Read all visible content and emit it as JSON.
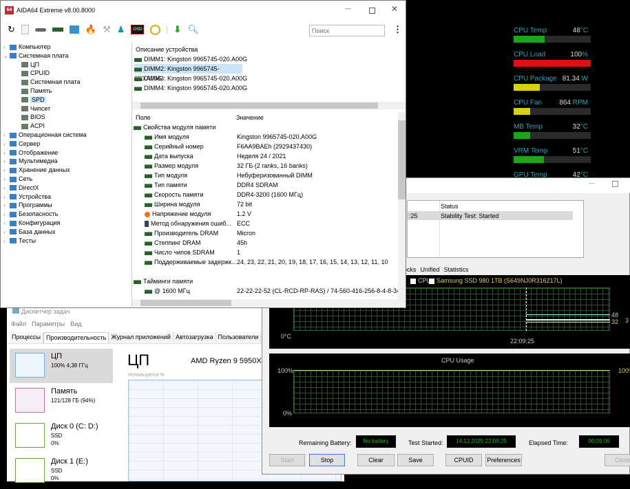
{
  "sensors": [
    {
      "label": "CPU Temp",
      "value": "48",
      "unit": "°C",
      "fill": 0.4,
      "color": "#1aa81a"
    },
    {
      "label": "CPU Load",
      "value": "100",
      "unit": "%",
      "fill": 1.0,
      "color": "#e01010"
    },
    {
      "label": "CPU Package",
      "value": "81.34",
      "unit": " W",
      "fill": 0.34,
      "color": "#d8d010"
    },
    {
      "label": "CPU Fan",
      "value": "864",
      "unit": " RPM",
      "fill": 0.21,
      "color": "#d8d010"
    },
    {
      "label": "MB Temp",
      "value": "32",
      "unit": "°C",
      "fill": 0.21,
      "color": "#1aa81a"
    },
    {
      "label": "VRM Temp",
      "value": "51",
      "unit": "°C",
      "fill": 0.39,
      "color": "#1aa81a"
    },
    {
      "label": "GPU Temp",
      "value": "42",
      "unit": "°C",
      "fill": 0.3,
      "color": "#1aa81a"
    }
  ],
  "stability": {
    "log_time": ":25",
    "status_header": "Status",
    "status_value": "Stability Test: Started",
    "tabs": [
      "ocks",
      "Unified",
      "Statistics"
    ],
    "legend": [
      "CPU",
      "Samsung SSD 980 1TB (S649NJ0R316217L)"
    ],
    "temp_axis_min": "0°C",
    "temp_time": "22:09:25",
    "temp_val1": "48",
    "temp_val2": "32",
    "temp_val3": "3",
    "cpu_usage_title": "CPU Usage",
    "cpu_axis_max": "100%",
    "cpu_axis_min": "0%",
    "cpu_right": "100%",
    "battery_label": "Remaining Battery:",
    "battery_value": "No battery",
    "started_label": "Test Started:",
    "started_value": "14.12.2025 22:09:25",
    "elapsed_label": "Elapsed Time:",
    "elapsed_value": "00:09:05",
    "buttons": {
      "start": "Start",
      "stop": "Stop",
      "clear": "Clear",
      "save": "Save",
      "cpuid": "CPUID",
      "preferences": "Preferences",
      "close": "Close"
    }
  },
  "taskmgr": {
    "title": "Диспетчер задач",
    "menu": [
      "Файл",
      "Параметры",
      "Вид"
    ],
    "tabs": [
      "Процессы",
      "Производительность",
      "Журнал приложений",
      "Автозагрузка",
      "Пользователи"
    ],
    "items": [
      {
        "name": "ЦП",
        "sub": "100% 4,38 ГГц",
        "sub2": ""
      },
      {
        "name": "Память",
        "sub": "121/128 ГБ (94%)",
        "sub2": ""
      },
      {
        "name": "Диск 0 (C: D:)",
        "sub": "SSD",
        "sub2": "0%"
      },
      {
        "name": "Диск 1 (E:)",
        "sub": "SSD",
        "sub2": "0%"
      }
    ],
    "heading": "ЦП",
    "cpu_model": "AMD Ryzen 9 5950X",
    "usage_label": "Используется %"
  },
  "aida": {
    "title": "AIDA64 Extreme v8.00.8000",
    "search_placeholder": "Поиск",
    "tree": [
      {
        "label": "Компьютер",
        "level": 0,
        "exp": ">"
      },
      {
        "label": "Системная плата",
        "level": 0,
        "exp": "v"
      },
      {
        "label": "ЦП",
        "level": 1
      },
      {
        "label": "CPUID",
        "level": 1
      },
      {
        "label": "Системная плата",
        "level": 1
      },
      {
        "label": "Память",
        "level": 1
      },
      {
        "label": "SPD",
        "level": 1,
        "selected": true
      },
      {
        "label": "Чипсет",
        "level": 1
      },
      {
        "label": "BIOS",
        "level": 1
      },
      {
        "label": "ACPI",
        "level": 1
      },
      {
        "label": "Операционная система",
        "level": 0,
        "exp": ">"
      },
      {
        "label": "Сервер",
        "level": 0,
        "exp": ">"
      },
      {
        "label": "Отображение",
        "level": 0,
        "exp": ">"
      },
      {
        "label": "Мультимедиа",
        "level": 0,
        "exp": ">"
      },
      {
        "label": "Хранение данных",
        "level": 0,
        "exp": ">"
      },
      {
        "label": "Сеть",
        "level": 0,
        "exp": ">"
      },
      {
        "label": "DirectX",
        "level": 0,
        "exp": ">"
      },
      {
        "label": "Устройства",
        "level": 0,
        "exp": ">"
      },
      {
        "label": "Программы",
        "level": 0,
        "exp": ">"
      },
      {
        "label": "Безопасность",
        "level": 0,
        "exp": ">"
      },
      {
        "label": "Конфигурация",
        "level": 0,
        "exp": ">"
      },
      {
        "label": "База данных",
        "level": 0,
        "exp": ">"
      },
      {
        "label": "Тесты",
        "level": 0,
        "exp": ">"
      }
    ],
    "device_header": "Описание устройства",
    "devices": [
      "DIMM1: Kingston 9965745-020.A00G",
      "DIMM2: Kingston 9965745-020.A00G",
      "DIMM3: Kingston 9965745-020.A00G",
      "DIMM4: Kingston 9965745-020.A00G"
    ],
    "selected_device": 1,
    "col_field": "Поле",
    "col_value": "Значение",
    "rows": [
      {
        "f": "Свойства модуля памяти",
        "v": "",
        "group": true
      },
      {
        "f": "Имя модуля",
        "v": "Kingston 9965745-020.A00G"
      },
      {
        "f": "Серийный номер",
        "v": "F6AA9BAEh (2929437430)"
      },
      {
        "f": "Дата выпуска",
        "v": "Неделя 24 / 2021"
      },
      {
        "f": "Размер модуля",
        "v": "32 ГБ (2 ranks, 16 banks)"
      },
      {
        "f": "Тип модуля",
        "v": "Небуферизованный DIMM"
      },
      {
        "f": "Тип памяти",
        "v": "DDR4 SDRAM"
      },
      {
        "f": "Скорость памяти",
        "v": "DDR4-3200 (1600 МГц)"
      },
      {
        "f": "Ширина модуля",
        "v": "72 bit"
      },
      {
        "f": "Напряжение модуля",
        "v": "1.2 V"
      },
      {
        "f": "Метод обнаружения ошиб...",
        "v": "ECC"
      },
      {
        "f": "Производитель DRAM",
        "v": "Micron"
      },
      {
        "f": "Степпинг DRAM",
        "v": "45h"
      },
      {
        "f": "Число чипов SDRAM",
        "v": "1"
      },
      {
        "f": "Поддерживаемые задержк...",
        "v": "24, 23, 22, 21, 20, 19, 18, 17, 16, 15, 14, 13, 12, 11, 10"
      },
      {
        "f": "",
        "v": "",
        "blank": true
      },
      {
        "f": "Тайминги памяти",
        "v": "",
        "group": true
      },
      {
        "f": "@ 1600 МГц",
        "v": "22-22-22-52  (CL-RCD-RP-RAS) / 74-560-416-256-8-4-8-34"
      }
    ]
  }
}
